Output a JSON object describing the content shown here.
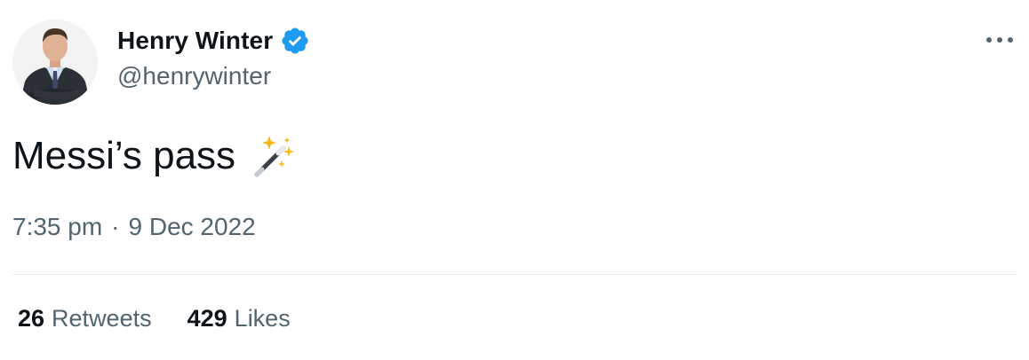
{
  "author": {
    "display_name": "Henry Winter",
    "handle": "@henrywinter",
    "verified": true,
    "verified_color": "#1d9bf0"
  },
  "tweet": {
    "text": "Messi’s pass",
    "emoji": "magic-wand-icon",
    "time": "7:35 pm",
    "separator": "·",
    "date": "9 Dec 2022"
  },
  "stats": {
    "retweets_count": "26",
    "retweets_label": "Retweets",
    "likes_count": "429",
    "likes_label": "Likes"
  },
  "colors": {
    "text_primary": "#0f1419",
    "text_secondary": "#536471",
    "divider": "#e6ecf0"
  }
}
